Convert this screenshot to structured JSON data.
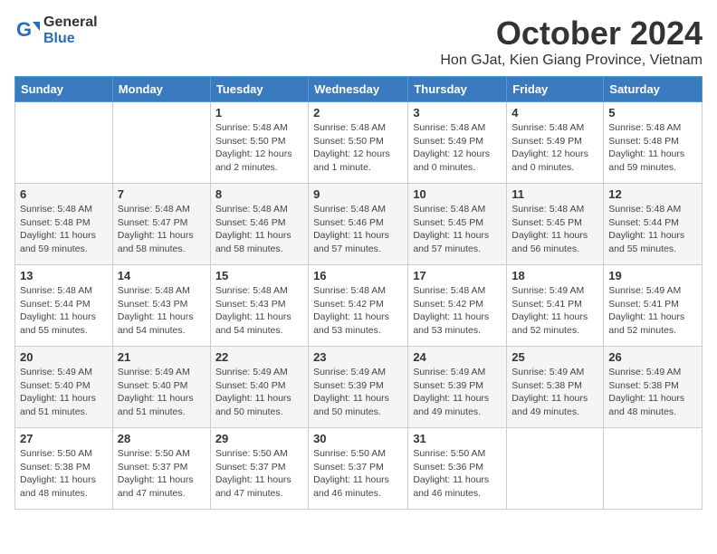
{
  "logo": {
    "general": "General",
    "blue": "Blue"
  },
  "title": "October 2024",
  "location": "Hon GJat, Kien Giang Province, Vietnam",
  "days_header": [
    "Sunday",
    "Monday",
    "Tuesday",
    "Wednesday",
    "Thursday",
    "Friday",
    "Saturday"
  ],
  "weeks": [
    [
      {
        "day": "",
        "detail": ""
      },
      {
        "day": "",
        "detail": ""
      },
      {
        "day": "1",
        "detail": "Sunrise: 5:48 AM\nSunset: 5:50 PM\nDaylight: 12 hours\nand 2 minutes."
      },
      {
        "day": "2",
        "detail": "Sunrise: 5:48 AM\nSunset: 5:50 PM\nDaylight: 12 hours\nand 1 minute."
      },
      {
        "day": "3",
        "detail": "Sunrise: 5:48 AM\nSunset: 5:49 PM\nDaylight: 12 hours\nand 0 minutes."
      },
      {
        "day": "4",
        "detail": "Sunrise: 5:48 AM\nSunset: 5:49 PM\nDaylight: 12 hours\nand 0 minutes."
      },
      {
        "day": "5",
        "detail": "Sunrise: 5:48 AM\nSunset: 5:48 PM\nDaylight: 11 hours\nand 59 minutes."
      }
    ],
    [
      {
        "day": "6",
        "detail": "Sunrise: 5:48 AM\nSunset: 5:48 PM\nDaylight: 11 hours\nand 59 minutes."
      },
      {
        "day": "7",
        "detail": "Sunrise: 5:48 AM\nSunset: 5:47 PM\nDaylight: 11 hours\nand 58 minutes."
      },
      {
        "day": "8",
        "detail": "Sunrise: 5:48 AM\nSunset: 5:46 PM\nDaylight: 11 hours\nand 58 minutes."
      },
      {
        "day": "9",
        "detail": "Sunrise: 5:48 AM\nSunset: 5:46 PM\nDaylight: 11 hours\nand 57 minutes."
      },
      {
        "day": "10",
        "detail": "Sunrise: 5:48 AM\nSunset: 5:45 PM\nDaylight: 11 hours\nand 57 minutes."
      },
      {
        "day": "11",
        "detail": "Sunrise: 5:48 AM\nSunset: 5:45 PM\nDaylight: 11 hours\nand 56 minutes."
      },
      {
        "day": "12",
        "detail": "Sunrise: 5:48 AM\nSunset: 5:44 PM\nDaylight: 11 hours\nand 55 minutes."
      }
    ],
    [
      {
        "day": "13",
        "detail": "Sunrise: 5:48 AM\nSunset: 5:44 PM\nDaylight: 11 hours\nand 55 minutes."
      },
      {
        "day": "14",
        "detail": "Sunrise: 5:48 AM\nSunset: 5:43 PM\nDaylight: 11 hours\nand 54 minutes."
      },
      {
        "day": "15",
        "detail": "Sunrise: 5:48 AM\nSunset: 5:43 PM\nDaylight: 11 hours\nand 54 minutes."
      },
      {
        "day": "16",
        "detail": "Sunrise: 5:48 AM\nSunset: 5:42 PM\nDaylight: 11 hours\nand 53 minutes."
      },
      {
        "day": "17",
        "detail": "Sunrise: 5:48 AM\nSunset: 5:42 PM\nDaylight: 11 hours\nand 53 minutes."
      },
      {
        "day": "18",
        "detail": "Sunrise: 5:49 AM\nSunset: 5:41 PM\nDaylight: 11 hours\nand 52 minutes."
      },
      {
        "day": "19",
        "detail": "Sunrise: 5:49 AM\nSunset: 5:41 PM\nDaylight: 11 hours\nand 52 minutes."
      }
    ],
    [
      {
        "day": "20",
        "detail": "Sunrise: 5:49 AM\nSunset: 5:40 PM\nDaylight: 11 hours\nand 51 minutes."
      },
      {
        "day": "21",
        "detail": "Sunrise: 5:49 AM\nSunset: 5:40 PM\nDaylight: 11 hours\nand 51 minutes."
      },
      {
        "day": "22",
        "detail": "Sunrise: 5:49 AM\nSunset: 5:40 PM\nDaylight: 11 hours\nand 50 minutes."
      },
      {
        "day": "23",
        "detail": "Sunrise: 5:49 AM\nSunset: 5:39 PM\nDaylight: 11 hours\nand 50 minutes."
      },
      {
        "day": "24",
        "detail": "Sunrise: 5:49 AM\nSunset: 5:39 PM\nDaylight: 11 hours\nand 49 minutes."
      },
      {
        "day": "25",
        "detail": "Sunrise: 5:49 AM\nSunset: 5:38 PM\nDaylight: 11 hours\nand 49 minutes."
      },
      {
        "day": "26",
        "detail": "Sunrise: 5:49 AM\nSunset: 5:38 PM\nDaylight: 11 hours\nand 48 minutes."
      }
    ],
    [
      {
        "day": "27",
        "detail": "Sunrise: 5:50 AM\nSunset: 5:38 PM\nDaylight: 11 hours\nand 48 minutes."
      },
      {
        "day": "28",
        "detail": "Sunrise: 5:50 AM\nSunset: 5:37 PM\nDaylight: 11 hours\nand 47 minutes."
      },
      {
        "day": "29",
        "detail": "Sunrise: 5:50 AM\nSunset: 5:37 PM\nDaylight: 11 hours\nand 47 minutes."
      },
      {
        "day": "30",
        "detail": "Sunrise: 5:50 AM\nSunset: 5:37 PM\nDaylight: 11 hours\nand 46 minutes."
      },
      {
        "day": "31",
        "detail": "Sunrise: 5:50 AM\nSunset: 5:36 PM\nDaylight: 11 hours\nand 46 minutes."
      },
      {
        "day": "",
        "detail": ""
      },
      {
        "day": "",
        "detail": ""
      }
    ]
  ]
}
